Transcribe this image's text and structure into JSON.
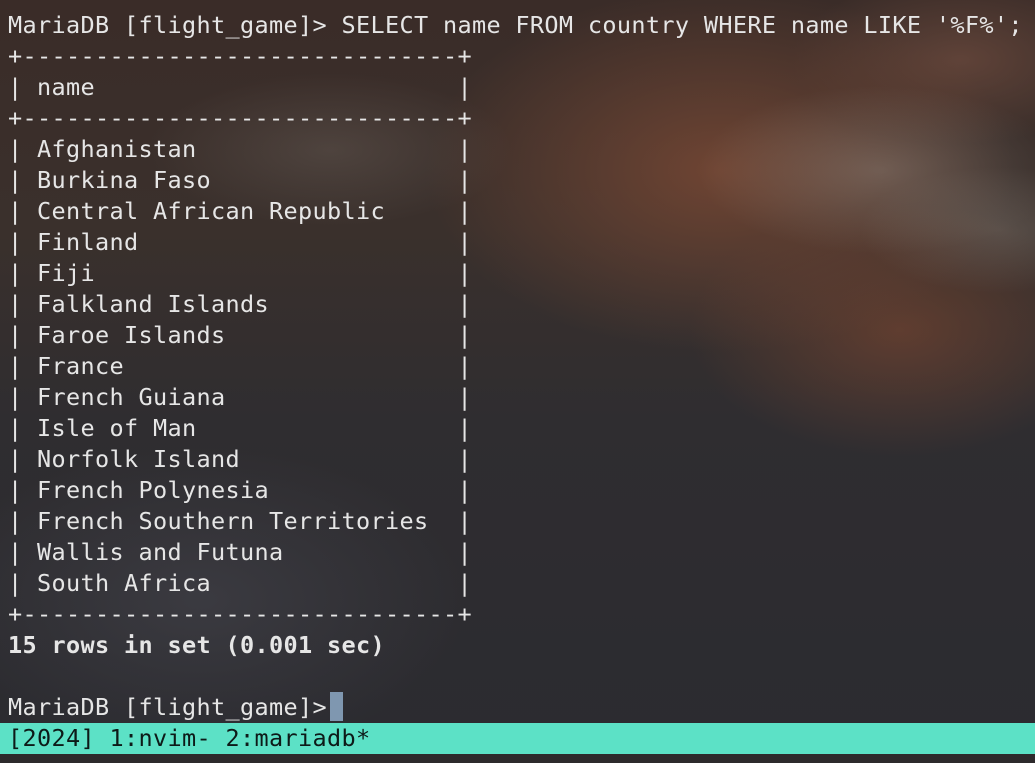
{
  "terminal": {
    "query_line": "MariaDB [flight_game]> SELECT name FROM country WHERE name LIKE '%F%';",
    "table_border": "+------------------------------+",
    "table_header": "| name                         |",
    "rows": [
      "| Afghanistan                  |",
      "| Burkina Faso                 |",
      "| Central African Republic     |",
      "| Finland                      |",
      "| Fiji                         |",
      "| Falkland Islands             |",
      "| Faroe Islands                |",
      "| France                       |",
      "| French Guiana                |",
      "| Isle of Man                  |",
      "| Norfolk Island               |",
      "| French Polynesia             |",
      "| French Southern Territories  |",
      "| Wallis and Futuna            |",
      "| South Africa                 |"
    ],
    "result_summary": "15 rows in set (0.001 sec)",
    "prompt": "MariaDB [flight_game]> "
  },
  "statusbar": {
    "text": "[2024] 1:nvim- 2:mariadb*"
  },
  "colors": {
    "statusbar_bg": "#5ce1c6",
    "cursor": "#7f97b0",
    "text": "#e6e6e6"
  }
}
